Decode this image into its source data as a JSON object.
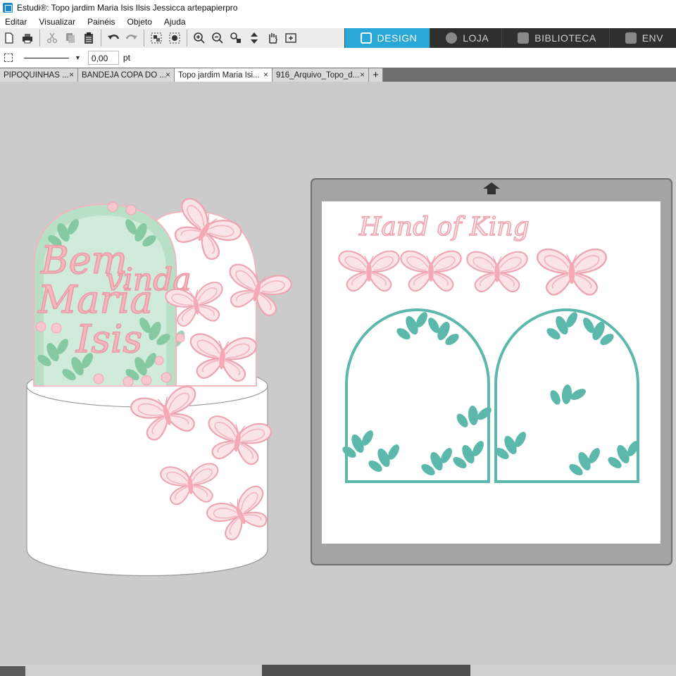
{
  "window": {
    "title": "Estudi®: Topo jardim Maria Isis Ilsis Jessicca artepapierpro"
  },
  "menu": [
    "Editar",
    "Visualizar",
    "Painéis",
    "Objeto",
    "Ajuda"
  ],
  "nav_tabs": [
    {
      "label": "DESIGN",
      "icon": "grid-icon",
      "active": true
    },
    {
      "label": "LOJA",
      "icon": "shop-icon",
      "active": false
    },
    {
      "label": "BIBLIOTECA",
      "icon": "library-icon",
      "active": false
    },
    {
      "label": "ENV",
      "icon": "send-icon",
      "active": false
    }
  ],
  "line_settings": {
    "value": "0,00",
    "unit": "pt"
  },
  "doc_tabs": [
    {
      "label": "PIPOQUINHAS ...",
      "active": false
    },
    {
      "label": "BANDEJA COPA DO ...",
      "active": false
    },
    {
      "label": "Topo jardim Maria Isi...",
      "active": true
    },
    {
      "label": "916_Arquivo_Topo_d...",
      "active": false
    }
  ],
  "design": {
    "topper_text": [
      "Bem",
      "vinda",
      "Maria",
      "Isis"
    ],
    "mat_heading": "Hand of King"
  },
  "colors": {
    "pink": "#f4b8bf",
    "pink_dark": "#e99aa5",
    "mint": "#9fd4b5",
    "teal": "#5cb8ab",
    "accent": "#29a8d8"
  }
}
